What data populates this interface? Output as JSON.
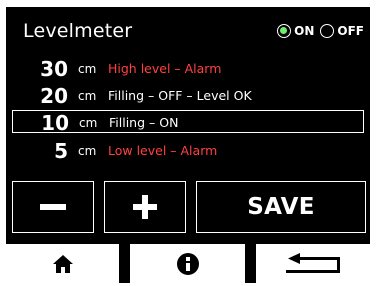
{
  "header": {
    "title": "Levelmeter",
    "power": {
      "on_label": "ON",
      "off_label": "OFF",
      "selected": "ON",
      "on_indicator_color": "#6ef06a"
    }
  },
  "levels": [
    {
      "value": "30",
      "unit": "cm",
      "description": "High level – Alarm",
      "alarm": true,
      "selected": false
    },
    {
      "value": "20",
      "unit": "cm",
      "description": "Filling – OFF – Level OK",
      "alarm": false,
      "selected": false
    },
    {
      "value": "10",
      "unit": "cm",
      "description": "Filling – ON",
      "alarm": false,
      "selected": true
    },
    {
      "value": "5",
      "unit": "cm",
      "description": "Low level – Alarm",
      "alarm": true,
      "selected": false
    }
  ],
  "controls": {
    "minus_icon": "minus-icon",
    "plus_icon": "plus-icon",
    "save_label": "SAVE"
  },
  "nav": {
    "home_icon": "home-icon",
    "info_icon": "info-icon",
    "back_icon": "return-arrow-icon"
  },
  "colors": {
    "background": "#000000",
    "foreground": "#ffffff",
    "alarm": "#ff4040"
  }
}
